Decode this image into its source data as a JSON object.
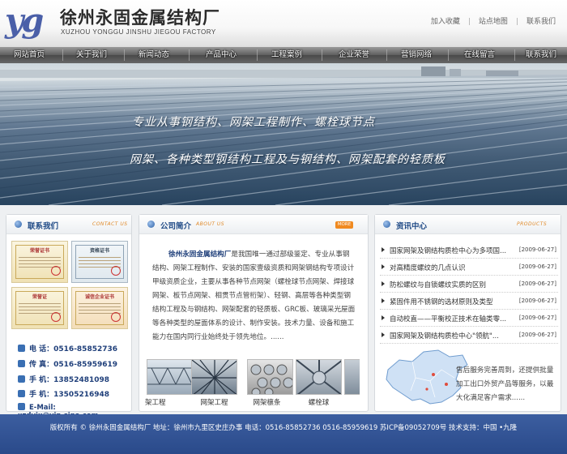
{
  "header": {
    "logo_mark": "yg",
    "title": "徐州永固金属结构厂",
    "subtitle": "XUZHOU YONGGU JINSHU JIEGOU FACTORY",
    "links": [
      "加入收藏",
      "站点地图",
      "联系我们"
    ],
    "link_separator": "|"
  },
  "nav": {
    "items": [
      "网站首页",
      "关于我们",
      "新闻动态",
      "产品中心",
      "工程案例",
      "企业荣誉",
      "营销网络",
      "在线留言",
      "联系我们"
    ]
  },
  "banner": {
    "line1": "专业从事钢结构、网架工程制作、螺栓球节点",
    "line2": "网架、各种类型钢结构工程及与钢结构、网架配套的轻质板"
  },
  "contact": {
    "title": "联系我们",
    "title_en": "CONTACT US",
    "certs": [
      "荣誉证书",
      "资格证书",
      "荣誉证",
      "诚信企业证书"
    ],
    "rows": [
      {
        "label": "电 话：",
        "value": "0516-85852736"
      },
      {
        "label": "传 真：",
        "value": "0516-85959619"
      },
      {
        "label": "手 机：",
        "value": "13852481098"
      },
      {
        "label": "手 机：",
        "value": "13505216948"
      },
      {
        "label": "E-Mail:",
        "value": "xzdyjx@vip.sina.com"
      }
    ]
  },
  "about": {
    "title": "公司简介",
    "title_en": "ABOUT US",
    "more": "MORE",
    "company": "徐州永固金属结构厂",
    "text": "是我国唯一通过部级鉴定、专业从事钢结构、网架工程制作、安装的国家壹级资质和网架钢结构专项设计甲级资质企业，主要从事各种节点网架（螺栓球节点网架、焊接球网架、板节点网架、相贯节点管桁架）、轻钢、高层等各种类型钢结构工程及与钢结构、网架配套的轻质板、GRC板、玻璃采光屋面等各种类型的屋面体系的设计、制作安装。技术力量、设备和施工能力在国内同行业始终处于领先地位。......",
    "gallery": [
      "网架工程",
      "网架工程",
      "网架檩条",
      "螺栓球"
    ]
  },
  "news": {
    "title": "资讯中心",
    "title_en": "PRODUCTS",
    "items": [
      {
        "title": "国家网架及钢结构质检中心为多项国...",
        "date": "[2009-06-27]"
      },
      {
        "title": "对高精度螺纹的几点认识",
        "date": "[2009-06-27]"
      },
      {
        "title": "防松螺纹与自锁螺纹实质的区别",
        "date": "[2009-06-27]"
      },
      {
        "title": "紧固件用不锈钢的选材原则及类型",
        "date": "[2009-06-27]"
      },
      {
        "title": "自动校直——平衡校正技术在轴类零...",
        "date": "[2009-06-27]"
      },
      {
        "title": "国家网架及钢结构质检中心\"领航\"...",
        "date": "[2009-06-27]"
      }
    ],
    "promo": "售后服务完善周到，还提供批量加工出口外贸产品等服务，以最大化满足客户需求......"
  },
  "footer": {
    "text": "版权所有 © 徐州永固金属结构厂  地址：徐州市九里区史庄办事    电话：0516-85852736 0516-85959619   苏ICP备09052709号    技术支持：中国 •九隆"
  },
  "colors": {
    "brand_blue": "#1f4a86",
    "nav_bg": "#5e5e5e",
    "footer_bg": "#2e4f91",
    "accent_orange": "#e08a2a"
  }
}
